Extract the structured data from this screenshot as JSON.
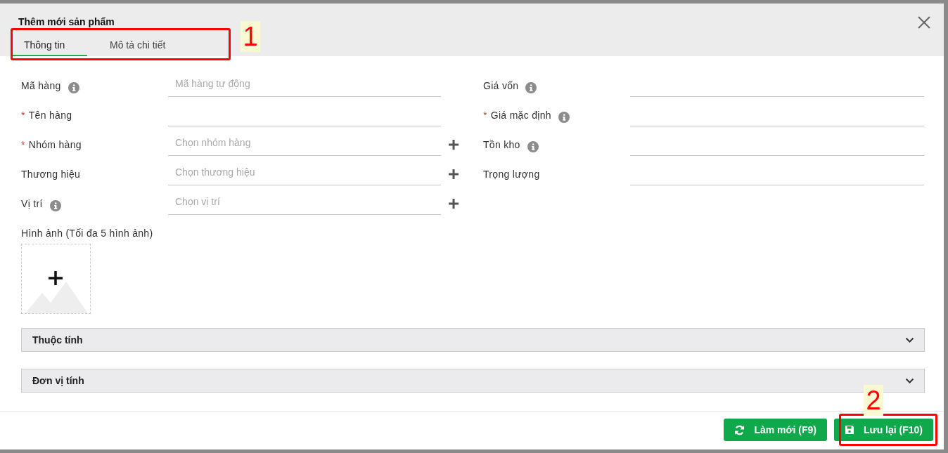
{
  "dialog": {
    "title": "Thêm mới sản phẩm"
  },
  "tabs": [
    {
      "label": "Thông tin",
      "selected": true
    },
    {
      "label": "Mô tả chi tiết",
      "selected": false
    }
  ],
  "left_fields": [
    {
      "label": "Mã hàng",
      "info": true,
      "placeholder": "Mã hàng tự động",
      "add_button": false
    },
    {
      "required_mark": "*",
      "label": "Tên hàng",
      "info": false,
      "add_button": false
    },
    {
      "required_mark": "*",
      "label": "Nhóm hàng",
      "info": false,
      "placeholder": "Chọn nhóm hàng",
      "add_button": true
    },
    {
      "label": "Thương hiệu",
      "info": false,
      "placeholder": "Chọn thương hiệu",
      "add_button": true
    },
    {
      "label": "Vị trí",
      "info": true,
      "placeholder": "Chọn vị trí",
      "add_button": true
    }
  ],
  "right_fields": [
    {
      "label": "Giá vốn",
      "info": true
    },
    {
      "required_mark": "*",
      "label": "Giá mặc định",
      "info": true
    },
    {
      "label": "Tồn kho",
      "info": true
    },
    {
      "label": "Trọng lượng",
      "info": false
    }
  ],
  "images": {
    "label": "Hình ảnh (Tối đa 5 hình ảnh)"
  },
  "sections": [
    {
      "title": "Thuộc tính",
      "expanded": false
    },
    {
      "title": "Đơn vị tính",
      "expanded": false
    }
  ],
  "buttons": [
    {
      "label": "Làm mới (F9)",
      "kind": "refresh"
    },
    {
      "label": "Lưu lại (F10)",
      "kind": "save"
    }
  ],
  "annotations": [
    {
      "label": "1"
    },
    {
      "label": "2"
    }
  ]
}
